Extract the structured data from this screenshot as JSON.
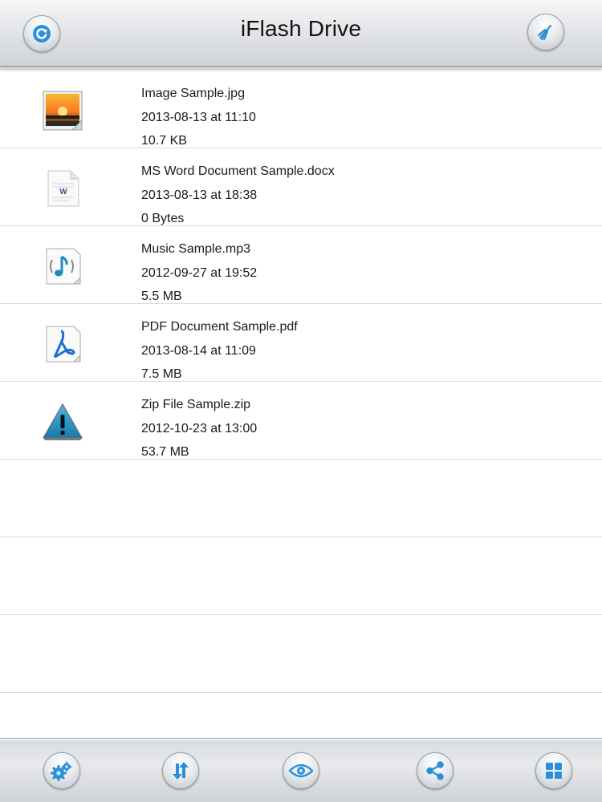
{
  "nav": {
    "title": "iFlash Drive",
    "left_icon": "refresh-icon",
    "right_icon": "clean-brush-icon"
  },
  "files": [
    {
      "name": "Image Sample.jpg",
      "date": "2013-08-13 at 11:10",
      "size": "10.7 KB",
      "icon": "image-file-icon"
    },
    {
      "name": "MS Word Document Sample.docx",
      "date": "2013-08-13 at 18:38",
      "size": "0 Bytes",
      "icon": "word-document-icon"
    },
    {
      "name": "Music Sample.mp3",
      "date": "2012-09-27 at 19:52",
      "size": "5.5 MB",
      "icon": "music-file-icon"
    },
    {
      "name": "PDF Document Sample.pdf",
      "date": "2013-08-14 at 11:09",
      "size": "7.5 MB",
      "icon": "pdf-document-icon"
    },
    {
      "name": "Zip File Sample.zip",
      "date": "2012-10-23 at 13:00",
      "size": "53.7 MB",
      "icon": "warning-icon"
    }
  ],
  "toolbar": {
    "icons": [
      "settings-gears-icon",
      "sort-arrows-icon",
      "eye-icon",
      "share-icon",
      "grid-view-icon"
    ]
  },
  "colors": {
    "accent_blue": "#2a8fd9",
    "row_divider": "#dcdcdc"
  }
}
